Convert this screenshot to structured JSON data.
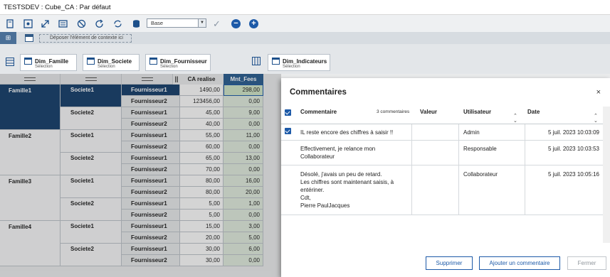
{
  "window": {
    "title": "TESTSDEV : Cube_CA : Par défaut"
  },
  "toolbar": {
    "base_select": "Base"
  },
  "context": {
    "drop_label": "Déposer l'élément de contexte ici"
  },
  "dims": [
    {
      "name": "Dim_Famille",
      "sub": "Sélection"
    },
    {
      "name": "Dim_Societe",
      "sub": "Sélection"
    },
    {
      "name": "Dim_Fournisseur",
      "sub": "Sélection"
    },
    {
      "name": "Dim_Indicateurs",
      "sub": "Sélection"
    }
  ],
  "grid": {
    "headers": {
      "realise": "CA realise",
      "fees": "Mnt_Fees",
      "sep": "||"
    },
    "familles": [
      "Famille1",
      "Famille2",
      "Famille3",
      "Famille4"
    ],
    "societes": [
      "Societe1",
      "Societe2"
    ],
    "fournisseurs": [
      "Fournisseur1",
      "Fournisseur2"
    ],
    "rows": [
      {
        "realise": "1490,00",
        "fees": "298,00"
      },
      {
        "realise": "123456,00",
        "fees": "0,00"
      },
      {
        "realise": "45,00",
        "fees": "9,00"
      },
      {
        "realise": "40,00",
        "fees": "0,00"
      },
      {
        "realise": "55,00",
        "fees": "11,00"
      },
      {
        "realise": "60,00",
        "fees": "0,00"
      },
      {
        "realise": "65,00",
        "fees": "13,00"
      },
      {
        "realise": "70,00",
        "fees": "0,00"
      },
      {
        "realise": "80,00",
        "fees": "16,00"
      },
      {
        "realise": "80,00",
        "fees": "20,00"
      },
      {
        "realise": "5,00",
        "fees": "1,00"
      },
      {
        "realise": "5,00",
        "fees": "0,00"
      },
      {
        "realise": "15,00",
        "fees": "3,00"
      },
      {
        "realise": "20,00",
        "fees": "5,00"
      },
      {
        "realise": "30,00",
        "fees": "6,00"
      },
      {
        "realise": "30,00",
        "fees": "0,00"
      }
    ]
  },
  "dialog": {
    "title": "Commentaires",
    "close": "×",
    "columns": {
      "commentaire": "Commentaire",
      "count": "3 commentaires",
      "valeur": "Valeur",
      "utilisateur": "Utilisateur",
      "date": "Date"
    },
    "comments": [
      {
        "text": "IL reste encore des chiffres à saisir !!",
        "valeur": "",
        "user": "Admin",
        "date": "5 juil. 2023 10:03:09",
        "checked": true
      },
      {
        "text": "Effectivement, je relance mon\nCollaborateur",
        "valeur": "",
        "user": "Responsable",
        "date": "5 juil. 2023 10:03:53",
        "checked": false
      },
      {
        "text": "Désolé, j'avais un peu de retard.\nLes chiffres sont maintenant saisis, à\nentériner.\nCdt,\nPierre PaulJacques",
        "valeur": "",
        "user": "Collaborateur",
        "date": "5 juil. 2023 10:05:16",
        "checked": false
      }
    ],
    "buttons": {
      "delete": "Supprimer",
      "add": "Ajouter un commentaire",
      "close": "Fermer"
    }
  },
  "colors": {
    "accent": "#1d5aa8",
    "selected_dark": "#163f6b",
    "fees_bg": "#dfeadc"
  }
}
